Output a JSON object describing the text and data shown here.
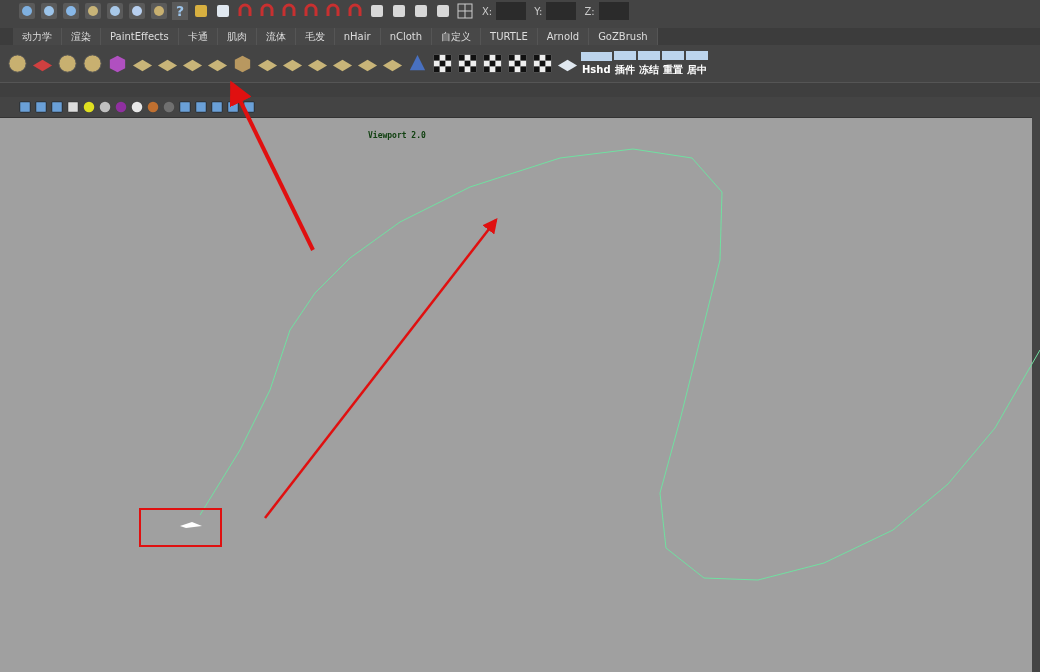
{
  "status_line": {
    "help_label": "?",
    "coords": [
      {
        "label": "X:"
      },
      {
        "label": "Y:"
      },
      {
        "label": "Z:"
      }
    ]
  },
  "shelf_tabs": [
    {
      "label": "动力学"
    },
    {
      "label": "渲染"
    },
    {
      "label": "PaintEffects"
    },
    {
      "label": "卡通"
    },
    {
      "label": "肌肉"
    },
    {
      "label": "流体"
    },
    {
      "label": "毛发"
    },
    {
      "label": "nHair"
    },
    {
      "label": "nCloth"
    },
    {
      "label": "自定义"
    },
    {
      "label": "TURTLE"
    },
    {
      "label": "Arnold"
    },
    {
      "label": "GoZBrush"
    }
  ],
  "shelf_labels": [
    "Hshd",
    "插件",
    "冻结",
    "重置",
    "居中"
  ],
  "viewport": {
    "renderer_label": "Viewport 2.0"
  }
}
